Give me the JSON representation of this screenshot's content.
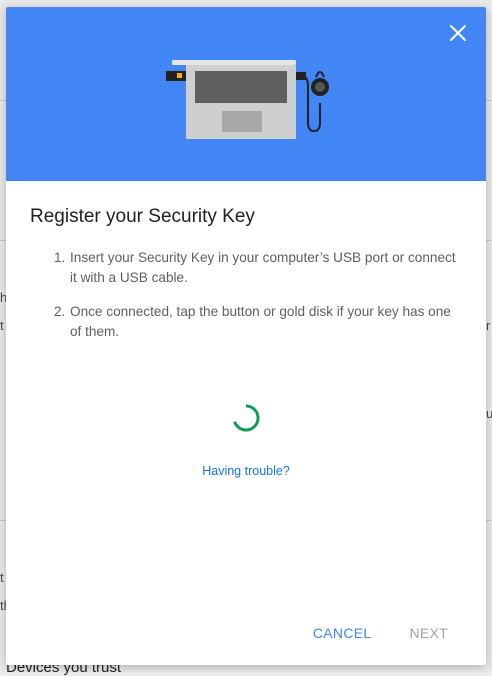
{
  "dialog": {
    "title": "Register your Security Key",
    "steps": [
      {
        "number": "1.",
        "text": "Insert your Security Key in your computer’s USB port or connect it with a USB cable."
      },
      {
        "number": "2.",
        "text": "Once connected, tap the button or gold disk if your key has one of them."
      }
    ],
    "trouble_link": "Having trouble?",
    "cancel_label": "CANCEL",
    "next_label": "NEXT",
    "header_color": "#4285f4",
    "spinner_color": "#0f9d58"
  },
  "background": {
    "left_fragment_1": "h",
    "left_fragment_2": "t",
    "right_fragment_1": "r",
    "right_fragment_2": "u",
    "left_fragment_3": "t",
    "left_fragment_4": "th",
    "footer_text": "Devices you trust"
  }
}
